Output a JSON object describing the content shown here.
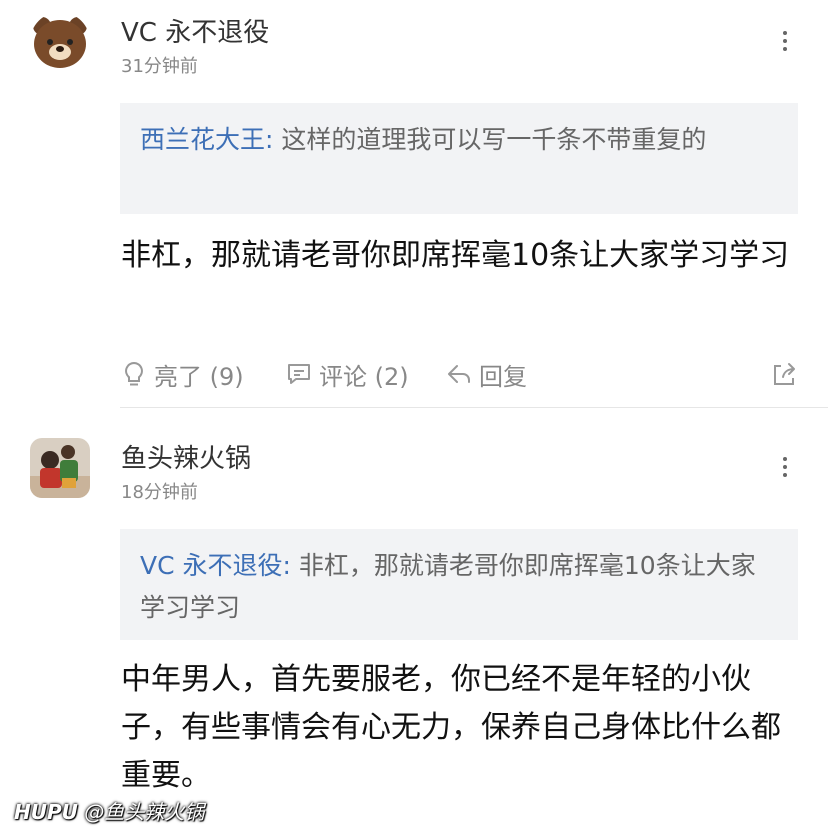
{
  "comments": [
    {
      "username": "VC 永不退役",
      "timestamp": "31分钟前",
      "quote_author": "西兰花大王:",
      "quote_text": " 这样的道理我可以写一千条不带重复的",
      "body": "非杠，那就请老哥你即席挥毫10条让大家学习学习",
      "avatar_icon": "brown-bear-avatar",
      "actions": {
        "like_label": "亮了 (9)",
        "comment_label": "评论 (2)",
        "reply_label": "回复"
      }
    },
    {
      "username": "鱼头辣火锅",
      "timestamp": "18分钟前",
      "quote_author": "VC 永不退役:",
      "quote_text": " 非杠，那就请老哥你即席挥毫10条让大家学习学习",
      "body": "中年男人，首先要服老，你已经不是年轻的小伙子，有些事情会有心无力，保养自己身体比什么都重要。",
      "avatar_icon": "photo-avatar"
    }
  ],
  "watermark": {
    "brand": "HUPU",
    "handle": "@鱼头辣火锅"
  },
  "colors": {
    "link": "#3d6fb6",
    "quote_bg": "#f2f3f5",
    "meta": "#888888"
  }
}
